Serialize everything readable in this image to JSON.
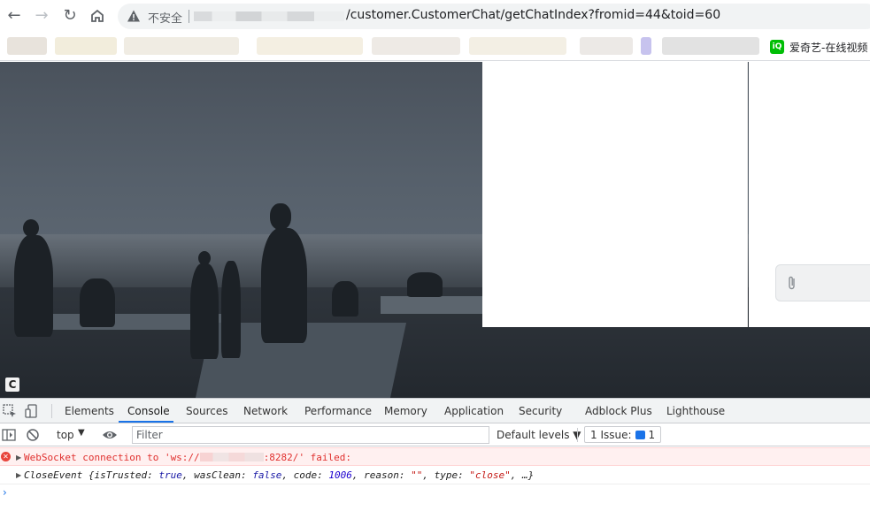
{
  "browser": {
    "insecure_label": "不安全",
    "url_visible": "/customer.CustomerChat/getChatIndex?fromid=44&toid=60",
    "bookmark_iqiyi": "爱奇艺-在线视频"
  },
  "page": {
    "badge_letter": "C"
  },
  "devtools": {
    "tabs": [
      "Elements",
      "Console",
      "Sources",
      "Network",
      "Performance",
      "Memory",
      "Application",
      "Security",
      "Adblock Plus",
      "Lighthouse"
    ],
    "active_tab": "Console",
    "context": "top",
    "filter_placeholder": "Filter",
    "levels": "Default levels ▼",
    "issues_label": "1 Issue:",
    "issues_count": "1",
    "error": {
      "prefix": "WebSocket connection to 'ws://",
      "port_path": ":8282/",
      "suffix": "' failed:"
    },
    "log": {
      "class": "CloseEvent",
      "isTrusted": "true",
      "wasClean": "false",
      "code": "1006",
      "reason": "\"\"",
      "type": "\"close\""
    }
  }
}
